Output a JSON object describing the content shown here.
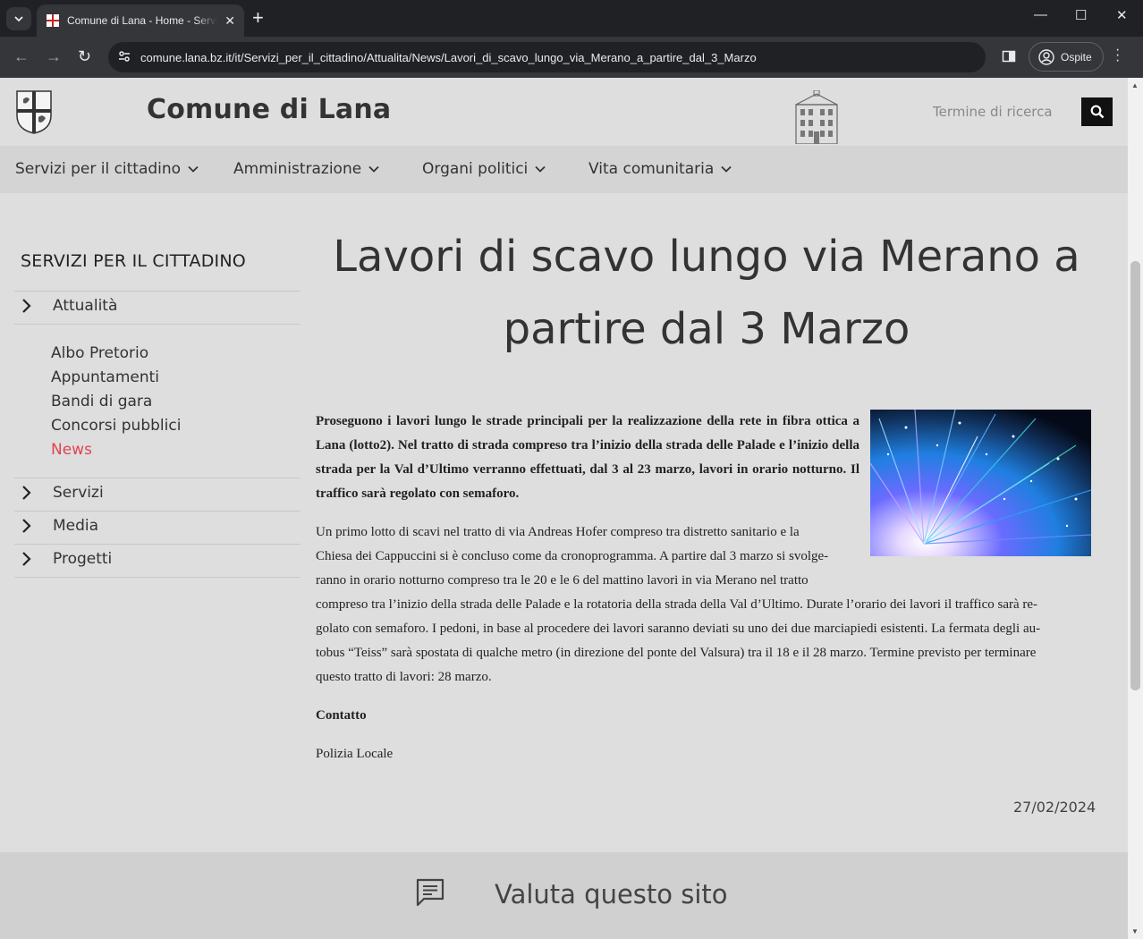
{
  "browser": {
    "tab_title": "Comune di Lana - Home - Servi",
    "url": "comune.lana.bz.it/it/Servizi_per_il_cittadino/Attualita/News/Lavori_di_scavo_lungo_via_Merano_a_partire_dal_3_Marzo",
    "profile_label": "Ospite"
  },
  "header": {
    "site_name": "Comune di Lana",
    "search_placeholder": "Termine di ricerca"
  },
  "nav": {
    "items": [
      {
        "label": "Servizi per il cittadino"
      },
      {
        "label": "Amministrazione"
      },
      {
        "label": "Organi politici"
      },
      {
        "label": "Vita comunitaria"
      }
    ]
  },
  "sidebar": {
    "title": "SERVIZI PER IL CITTADINO",
    "sections": [
      {
        "label": "Attualità"
      },
      {
        "label": "Servizi"
      },
      {
        "label": "Media"
      },
      {
        "label": "Progetti"
      }
    ],
    "subitems": [
      {
        "label": "Albo Pretorio"
      },
      {
        "label": "Appuntamenti"
      },
      {
        "label": "Bandi di gara"
      },
      {
        "label": "Concorsi pubblici"
      },
      {
        "label": "News",
        "active": true
      }
    ],
    "active_color": "#e0454f"
  },
  "article": {
    "title_line1": "Lavori di scavo lungo via Merano a",
    "title_line2": "partire dal 3 Marzo",
    "lead": "Proseguono i lavori lungo le strade principali per la realizzazione della rete in fibra ottica a Lana (lotto2). Nel tratto di strada compreso tra l’inizio della strada delle Palade e l’inizio della strada per la Val d’Ultimo verranno effettuati, dal 3 al 23 marzo, lavori in orario notturno. Il traffico sarà regolato con semaforo.",
    "body_lines": [
      "Un primo lotto di scavi nel tratto di via Andreas Hofer compreso tra distretto sanitario e la",
      "Chiesa dei Cappuccini si è concluso come da cronoprogramma. A partire dal 3 marzo si svolge-",
      "ranno in orario notturno compreso tra le 20 e le 6 del mattino lavori in via Merano nel tratto",
      "compreso tra l’inizio della strada delle Palade e la rotatoria della strada della Val d’Ultimo. Durate l’orario dei lavori il traffico sarà re-",
      "golato con semaforo. I pedoni, in base al procedere dei lavori saranno deviati su uno dei due marciapiedi esistenti. La fermata degli au-",
      "tobus “Teiss” sarà spostata di qualche metro (in direzione del ponte del Valsura) tra il 18 e il 28 marzo. Termine previsto per terminare",
      "questo tratto di lavori: 28 marzo."
    ],
    "contact_heading": "Contatto",
    "contact_value": "Polizia Locale",
    "date": "27/02/2024"
  },
  "footer": {
    "rate_label": "Valuta questo sito"
  }
}
